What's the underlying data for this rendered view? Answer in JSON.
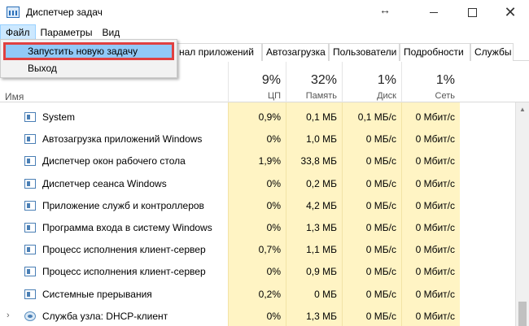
{
  "window": {
    "title": "Диспетчер задач",
    "close_glyph": "✕",
    "resize_glyph": "↔"
  },
  "menubar": {
    "items": [
      "Файл",
      "Параметры",
      "Вид"
    ]
  },
  "dropdown": {
    "items": [
      "Запустить новую задачу",
      "Выход"
    ]
  },
  "tabs": [
    "нал приложений",
    "Автозагрузка",
    "Пользователи",
    "Подробности",
    "Службы"
  ],
  "header": {
    "name_label": "Имя",
    "columns": [
      {
        "pct": "9%",
        "label": "ЦП"
      },
      {
        "pct": "32%",
        "label": "Память"
      },
      {
        "pct": "1%",
        "label": "Диск"
      },
      {
        "pct": "1%",
        "label": "Сеть"
      }
    ]
  },
  "processes": [
    {
      "name": "System",
      "cpu": "0,9%",
      "mem": "0,1 МБ",
      "disk": "0,1 МБ/с",
      "net": "0 Мбит/с",
      "expand": "",
      "icon": "window-icon"
    },
    {
      "name": "Автозагрузка приложений Windows",
      "cpu": "0%",
      "mem": "1,0 МБ",
      "disk": "0 МБ/с",
      "net": "0 Мбит/с",
      "expand": "",
      "icon": "window-icon"
    },
    {
      "name": "Диспетчер окон рабочего стола",
      "cpu": "1,9%",
      "mem": "33,8 МБ",
      "disk": "0 МБ/с",
      "net": "0 Мбит/с",
      "expand": "",
      "icon": "window-icon"
    },
    {
      "name": "Диспетчер сеанса  Windows",
      "cpu": "0%",
      "mem": "0,2 МБ",
      "disk": "0 МБ/с",
      "net": "0 Мбит/с",
      "expand": "",
      "icon": "window-icon"
    },
    {
      "name": "Приложение служб и контроллеров",
      "cpu": "0%",
      "mem": "4,2 МБ",
      "disk": "0 МБ/с",
      "net": "0 Мбит/с",
      "expand": "",
      "icon": "window-icon"
    },
    {
      "name": "Программа входа в систему Windows",
      "cpu": "0%",
      "mem": "1,3 МБ",
      "disk": "0 МБ/с",
      "net": "0 Мбит/с",
      "expand": "",
      "icon": "window-icon"
    },
    {
      "name": "Процесс исполнения клиент-сервер",
      "cpu": "0,7%",
      "mem": "1,1 МБ",
      "disk": "0 МБ/с",
      "net": "0 Мбит/с",
      "expand": "",
      "icon": "window-icon"
    },
    {
      "name": "Процесс исполнения клиент-сервер",
      "cpu": "0%",
      "mem": "0,9 МБ",
      "disk": "0 МБ/с",
      "net": "0 Мбит/с",
      "expand": "",
      "icon": "window-icon"
    },
    {
      "name": "Системные прерывания",
      "cpu": "0,2%",
      "mem": "0 МБ",
      "disk": "0 МБ/с",
      "net": "0 Мбит/с",
      "expand": "",
      "icon": "window-icon"
    },
    {
      "name": "Служба узла: DHCP-клиент",
      "cpu": "0%",
      "mem": "1,3 МБ",
      "disk": "0 МБ/с",
      "net": "0 Мбит/с",
      "expand": "›",
      "icon": "gear-icon"
    }
  ]
}
